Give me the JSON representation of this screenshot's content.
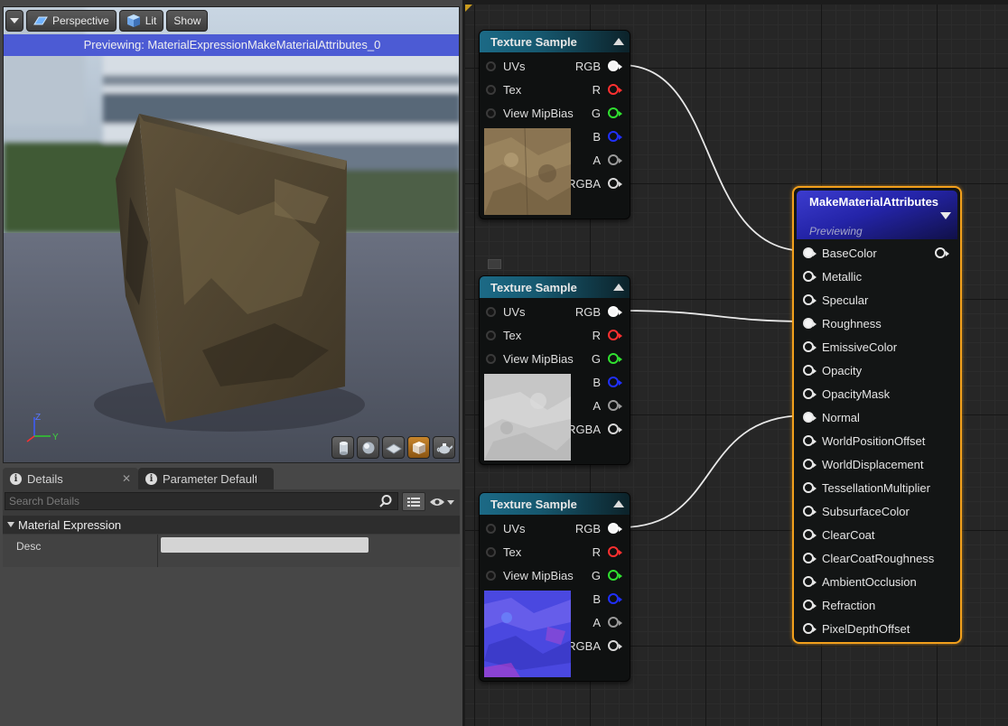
{
  "viewport": {
    "perspective_label": "Perspective",
    "lit_label": "Lit",
    "show_label": "Show",
    "preview_text": "Previewing: MaterialExpressionMakeMaterialAttributes_0",
    "axis_z": "Z",
    "axis_y": "Y",
    "preview_modes": [
      "cylinder",
      "sphere",
      "plane",
      "cube",
      "teapot"
    ],
    "active_mode": "cube"
  },
  "tabs": [
    {
      "label": "Details",
      "closable": true
    },
    {
      "label": "Parameter Defaults",
      "closable": false
    }
  ],
  "details": {
    "search_placeholder": "Search Details",
    "category": "Material Expression",
    "desc_label": "Desc",
    "desc_value": ""
  },
  "texture_nodes": [
    {
      "title": "Texture Sample",
      "inputs": [
        "UVs",
        "Tex",
        "View MipBias"
      ],
      "outputs": [
        {
          "label": "RGB",
          "color": "#ffffff"
        },
        {
          "label": "R",
          "color": "#ff3030"
        },
        {
          "label": "G",
          "color": "#30e030"
        },
        {
          "label": "B",
          "color": "#2030ff"
        },
        {
          "label": "A",
          "color": "#9a9a9a"
        },
        {
          "label": "RGBA",
          "color": "#d8d8d8"
        }
      ],
      "thumbnail": "base-color-texture"
    },
    {
      "title": "Texture Sample",
      "inputs": [
        "UVs",
        "Tex",
        "View MipBias"
      ],
      "outputs": [
        {
          "label": "RGB",
          "color": "#ffffff"
        },
        {
          "label": "R",
          "color": "#ff3030"
        },
        {
          "label": "G",
          "color": "#30e030"
        },
        {
          "label": "B",
          "color": "#2030ff"
        },
        {
          "label": "A",
          "color": "#9a9a9a"
        },
        {
          "label": "RGBA",
          "color": "#d8d8d8"
        }
      ],
      "thumbnail": "roughness-texture"
    },
    {
      "title": "Texture Sample",
      "inputs": [
        "UVs",
        "Tex",
        "View MipBias"
      ],
      "outputs": [
        {
          "label": "RGB",
          "color": "#ffffff"
        },
        {
          "label": "R",
          "color": "#ff3030"
        },
        {
          "label": "G",
          "color": "#30e030"
        },
        {
          "label": "B",
          "color": "#2030ff"
        },
        {
          "label": "A",
          "color": "#9a9a9a"
        },
        {
          "label": "RGBA",
          "color": "#d8d8d8"
        }
      ],
      "thumbnail": "normal-map-texture"
    }
  ],
  "make_material_attributes": {
    "title": "MakeMaterialAttributes",
    "subtitle": "Previewing",
    "inputs": [
      {
        "label": "BaseColor",
        "connected": true
      },
      {
        "label": "Metallic",
        "connected": false
      },
      {
        "label": "Specular",
        "connected": false
      },
      {
        "label": "Roughness",
        "connected": true
      },
      {
        "label": "EmissiveColor",
        "connected": false
      },
      {
        "label": "Opacity",
        "connected": false
      },
      {
        "label": "OpacityMask",
        "connected": false
      },
      {
        "label": "Normal",
        "connected": true
      },
      {
        "label": "WorldPositionOffset",
        "connected": false
      },
      {
        "label": "WorldDisplacement",
        "connected": false
      },
      {
        "label": "TessellationMultiplier",
        "connected": false
      },
      {
        "label": "SubsurfaceColor",
        "connected": false
      },
      {
        "label": "ClearCoat",
        "connected": false
      },
      {
        "label": "ClearCoatRoughness",
        "connected": false
      },
      {
        "label": "AmbientOcclusion",
        "connected": false
      },
      {
        "label": "Refraction",
        "connected": false
      },
      {
        "label": "PixelDepthOffset",
        "connected": false
      }
    ]
  },
  "colors": {
    "selection_outline": "#f2a01c",
    "preview_bar": "#4c5bd4",
    "texture_header": "#1c6a86",
    "attributes_header": "#2424a8"
  }
}
